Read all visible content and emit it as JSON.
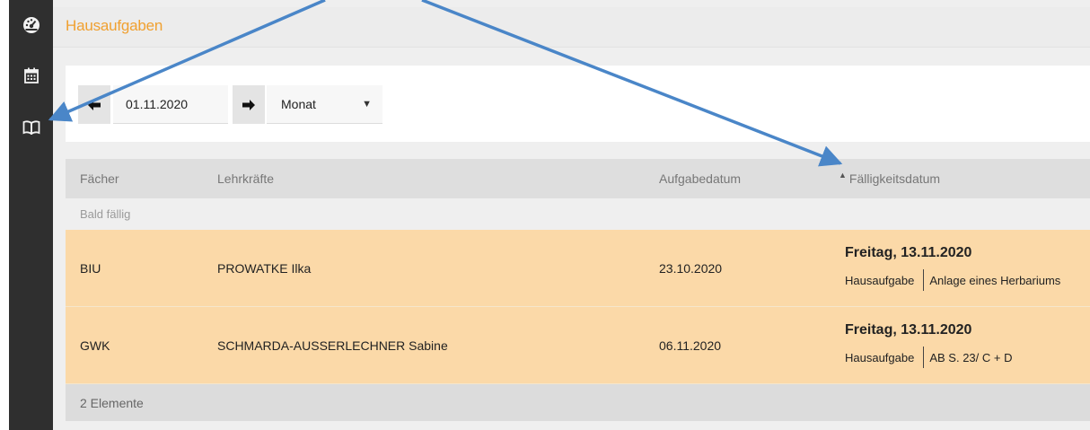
{
  "sidebar": {
    "icons": [
      {
        "name": "dashboard-icon"
      },
      {
        "name": "calendar-icon"
      },
      {
        "name": "book-icon"
      }
    ]
  },
  "header": {
    "title": "Hausaufgaben"
  },
  "toolbar": {
    "date_value": "01.11.2020",
    "period_value": "Monat",
    "prev_icon": "arrow-left-icon",
    "next_icon": "arrow-right-icon"
  },
  "table": {
    "columns": {
      "subject": "Fächer",
      "teacher": "Lehrkräfte",
      "assigned": "Aufgabedatum",
      "due": "Fälligkeitsdatum"
    },
    "group_label": "Bald fällig",
    "rows": [
      {
        "subject": "BIU",
        "teacher": "PROWATKE Ilka",
        "assigned": "23.10.2020",
        "due_date": "Freitag, 13.11.2020",
        "type": "Hausaufgabe",
        "description": "Anlage eines Herbariums"
      },
      {
        "subject": "GWK",
        "teacher": "SCHMARDA-AUSSERLECHNER Sabine",
        "assigned": "06.11.2020",
        "due_date": "Freitag, 13.11.2020",
        "type": "Hausaufgabe",
        "description": "AB S. 23/ C + D"
      }
    ],
    "footer": "2 Elemente"
  },
  "colors": {
    "accent": "#f0a030",
    "row_highlight": "#fbd9a8",
    "sidebar": "#2f2f2f",
    "annotation_arrow": "#4a86c8"
  }
}
